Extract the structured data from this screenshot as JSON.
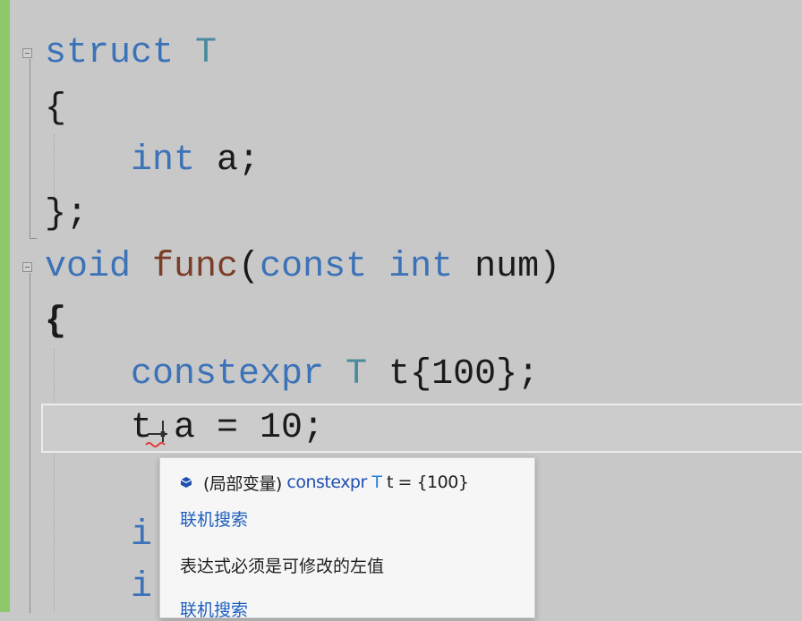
{
  "editor": {
    "lines": {
      "l1": {
        "kw": "struct",
        "ty": "T"
      },
      "l2": {
        "text": "{"
      },
      "l3": {
        "kw": "int",
        "rest": "a;"
      },
      "l4": {
        "text": "};"
      },
      "l5": {
        "kw": "void",
        "fn": "func",
        "p1": "(",
        "kw2": "const",
        "kw3": "int",
        "rest": "num)"
      },
      "l6": {
        "text": "{"
      },
      "l7": {
        "kw": "constexpr",
        "ty": "T",
        "rest": "t{100};"
      },
      "l8": {
        "t": "t",
        "rest": ".a = 10;"
      },
      "l9": {
        "text": "i"
      },
      "l10": {
        "text": "i"
      }
    }
  },
  "tooltip": {
    "icon": "local-variable-icon",
    "prefix": "(局部变量)",
    "kw": "constexpr",
    "ty": "T",
    "rest": "t = {100}",
    "link1": "联机搜索",
    "error": "表达式必须是可修改的左值",
    "link2": "联机搜索"
  },
  "colors": {
    "keyword": "#3b72b8",
    "type": "#4b8a9e",
    "function": "#7a3d28",
    "link": "#1f5fbf",
    "gutter": "#8dc86a"
  }
}
